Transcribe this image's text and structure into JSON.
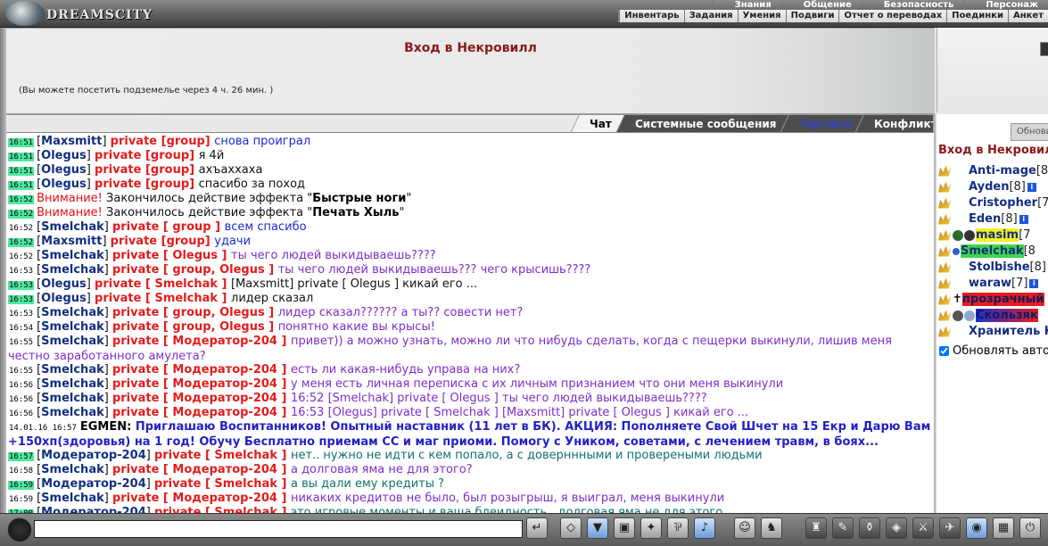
{
  "app": {
    "logo": "DREAMSCITY"
  },
  "menu_top": [
    "Знания",
    "Общение",
    "Безопасность",
    "Персонаж"
  ],
  "menu_bottom": [
    "Инвентарь",
    "Задания",
    "Умения",
    "Подвиги",
    "Отчет о переводах",
    "Поединки",
    "Анкет"
  ],
  "location": {
    "title": "Вход в Некровилл",
    "note": "(Вы можете посетить подземелье через 4 ч. 26 мин. )"
  },
  "tabs": [
    "Чат",
    "Системные сообщения",
    "Торговля",
    "Конфликты"
  ],
  "chat": [
    {
      "time": "16:51",
      "hl": true,
      "nick": "Maxsmitt",
      "to": "private [group]",
      "text": "снова проиграл",
      "color": "clr-blue"
    },
    {
      "time": "16:51",
      "hl": true,
      "nick": "Olegus",
      "to": "private [group]",
      "text": "я 4й",
      "color": "clr-black"
    },
    {
      "time": "16:51",
      "hl": true,
      "nick": "Olegus",
      "to": "private [group]",
      "text": "ахъаххаха",
      "color": "clr-black"
    },
    {
      "time": "16:51",
      "hl": true,
      "nick": "Olegus",
      "to": "private [group]",
      "text": "спасибо за поход",
      "color": "clr-black"
    },
    {
      "time": "16:52",
      "hl": true,
      "warn": "Внимание!",
      "pre": "Закончилось действие эффекта \"",
      "bold": "Быстрые ноги",
      "post": "\""
    },
    {
      "time": "16:52",
      "hl": true,
      "warn": "Внимание!",
      "pre": "Закончилось действие эффекта \"",
      "bold": "Печать Хыль",
      "post": "\""
    },
    {
      "time": "16:52",
      "hl": false,
      "nick": "Smelchak",
      "to": "private [ group ]",
      "text": "всем спасибо",
      "color": "clr-blue"
    },
    {
      "time": "16:52",
      "hl": true,
      "nick": "Maxsmitt",
      "to": "private [group]",
      "text": "удачи",
      "color": "clr-blue"
    },
    {
      "time": "16:52",
      "hl": false,
      "nick": "Smelchak",
      "to": "private [ Olegus ]",
      "text": "ты чего людей выкидываешь????",
      "color": "clr-purple"
    },
    {
      "time": "16:53",
      "hl": false,
      "nick": "Smelchak",
      "to": "private [ group, Olegus ]",
      "text": "ты чего людей выкидываешь??? чего крысишь????",
      "color": "clr-purple"
    },
    {
      "time": "16:53",
      "hl": true,
      "nick": "Olegus",
      "to": "private [ Smelchak ]",
      "text": "[Maxsmitt] private [ Olegus ] кикай его ...",
      "color": "clr-black"
    },
    {
      "time": "16:53",
      "hl": true,
      "nick": "Olegus",
      "to": "private [ Smelchak ]",
      "text": "лидер сказал",
      "color": "clr-black"
    },
    {
      "time": "16:53",
      "hl": false,
      "nick": "Smelchak",
      "to": "private [ group, Olegus ]",
      "text": "лидер сказал?????? а ты?? совести нет?",
      "color": "clr-purple"
    },
    {
      "time": "16:54",
      "hl": false,
      "nick": "Smelchak",
      "to": "private [ group, Olegus ]",
      "text": "понятно какие вы крысы!",
      "color": "clr-purple"
    },
    {
      "time": "16:55",
      "hl": false,
      "nick": "Smelchak",
      "to": "private [ Модератор-204 ]",
      "text": "привет)) а можно узнать, можно ли что нибудь сделать, когда с пещерки выкинули, лишив меня честно заработанного амулета?",
      "color": "clr-purple",
      "two_lines": true
    },
    {
      "time": "16:55",
      "hl": false,
      "nick": "Smelchak",
      "to": "private [ Модератор-204 ]",
      "text": "есть ли какая-нибудь управа на них?",
      "color": "clr-purple"
    },
    {
      "time": "16:56",
      "hl": false,
      "nick": "Smelchak",
      "to": "private [ Модератор-204 ]",
      "text": "у меня есть личная переписка с их личным признанием что они меня выкинули",
      "color": "clr-purple"
    },
    {
      "time": "16:56",
      "hl": false,
      "nick": "Smelchak",
      "to": "private [ Модератор-204 ]",
      "text": "16:52 [Smelchak] private [ Olegus ] ты чего людей выкидываешь????",
      "color": "clr-purple"
    },
    {
      "time": "16:56",
      "hl": false,
      "nick": "Smelchak",
      "to": "private [ Модератор-204 ]",
      "text": "16:53 [Olegus] private [ Smelchak ] [Maxsmitt] private [ Olegus ] кикай его ...",
      "color": "clr-purple"
    },
    {
      "sys": true,
      "time": "14.01.16 16:57",
      "sysnick": "EGMEN:",
      "text": "Приглашаю Воспитанников! Опытный наставник (11 лет в БК). АКЦИЯ: Пополняете Свой Шчет на 15 Екр и Дарю Вам +150хп(здоровья) на 1 год! Обучу Бесплатно приемам СС и маг приоми. Помогу с Уником, советами, с лечением травм, в боях..."
    },
    {
      "time": "16:57",
      "hl": true,
      "nick": "Модератор-204",
      "to": "private [ Smelchak ]",
      "text": "нет.. нужно не идти с кем попало, а с доверннными и провереными людьми",
      "color": "clr-teal"
    },
    {
      "time": "16:58",
      "hl": false,
      "nick": "Smelchak",
      "to": "private [ Модератор-204 ]",
      "text": "а долговая яма не для этого?",
      "color": "clr-purple"
    },
    {
      "time": "16:59",
      "hl": true,
      "nick": "Модератор-204",
      "to": "private [ Smelchak ]",
      "text": "а вы дали ему кредиты ?",
      "color": "clr-teal"
    },
    {
      "time": "16:59",
      "hl": false,
      "nick": "Smelchak",
      "to": "private [ Модератор-204 ]",
      "text": "никаких кредитов не было, был розыгрыш, я выиграл, меня выкинули",
      "color": "clr-purple"
    },
    {
      "time": "17:00",
      "hl": true,
      "nick": "Модератор-204",
      "to": "private [ Smelchak ]",
      "text": "это игровые моменты и ваша блеидность , долговая яма не для этого",
      "color": "clr-teal"
    }
  ],
  "users_panel": {
    "refresh_label": "Обновить",
    "title": "Вход в Некровилл",
    "auto_refresh_label": "Обновлять автоматически",
    "users": [
      {
        "name": "Anti-mage",
        "level": "[8",
        "info": false,
        "style": ""
      },
      {
        "name": "Ayden",
        "level": "[8]",
        "info": true,
        "style": ""
      },
      {
        "name": "Cristopher",
        "level": "[7",
        "info": false,
        "style": ""
      },
      {
        "name": "Eden",
        "level": "[8]",
        "info": true,
        "style": ""
      },
      {
        "name": "masim",
        "level": "[7",
        "info": false,
        "style": "yellow",
        "badges": true
      },
      {
        "name": "Smelchak",
        "level": "[8",
        "info": false,
        "style": "green",
        "badge1": true
      },
      {
        "name": "Stolbishe",
        "level": "[8]",
        "info": false,
        "style": ""
      },
      {
        "name": "waraw",
        "level": "[7]",
        "info": true,
        "style": ""
      },
      {
        "name": "прозрачный",
        "level": "",
        "info": false,
        "style": "red",
        "cross": true
      },
      {
        "name": "Скользяк",
        "level": "",
        "info": false,
        "style": "redblue",
        "badges2": true
      },
      {
        "name": "Хранитель К",
        "level": "",
        "info": false,
        "style": ""
      }
    ]
  },
  "toolbar": {
    "input_value": "",
    "icons": [
      "enter-icon",
      "eraser-icon",
      "filter-icon",
      "save-icon",
      "walk-icon",
      "translit-icon",
      "music-icon",
      "smile-icon",
      "helmet-icon",
      "bag-icon",
      "scroll-icon",
      "potion-icon",
      "chest-icon",
      "sword-icon",
      "map-icon",
      "globe-icon",
      "portrait-icon",
      "exit-icon"
    ]
  }
}
